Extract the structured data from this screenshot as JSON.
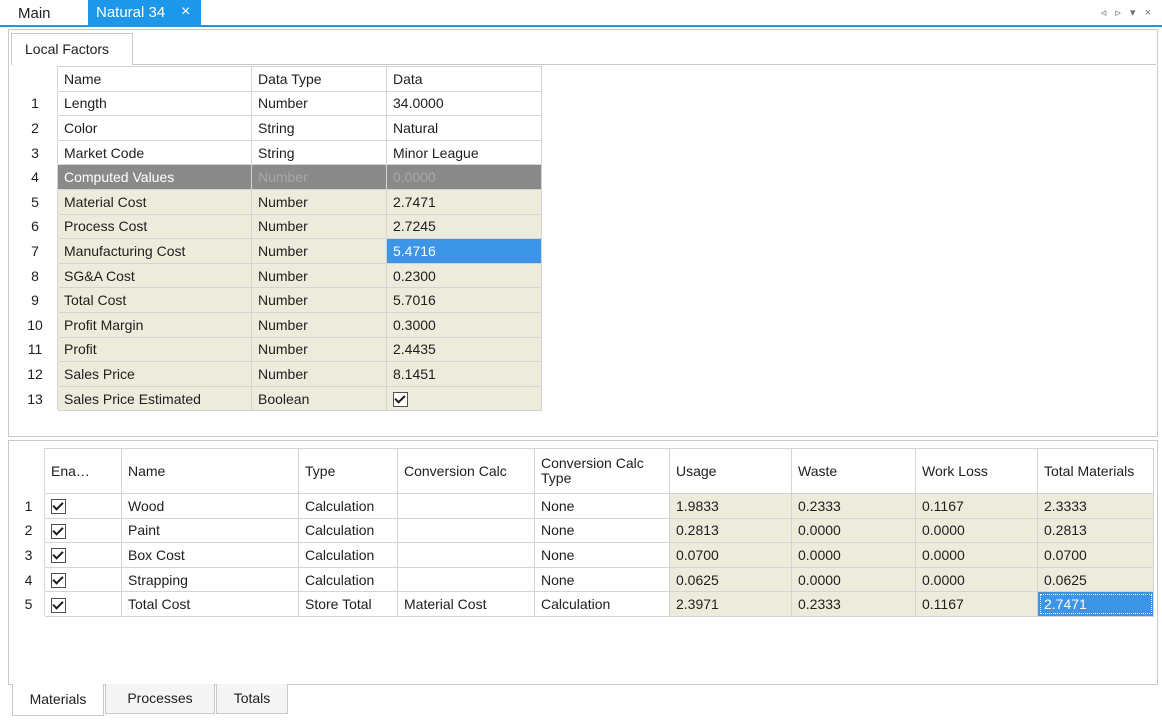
{
  "doc_tabs": {
    "main": "Main",
    "active": "Natural 34",
    "close_glyph": "×"
  },
  "strip_controls": {
    "left": "◃",
    "right": "▹",
    "menu": "▾",
    "close": "×"
  },
  "local_factors": {
    "tab_label": "Local Factors",
    "headers": {
      "name": "Name",
      "data_type": "Data Type",
      "data": "Data"
    },
    "rows": [
      {
        "num": "1",
        "name": "Length",
        "type": "Number",
        "data": "34.0000"
      },
      {
        "num": "2",
        "name": "Color",
        "type": "String",
        "data": "Natural"
      },
      {
        "num": "3",
        "name": "Market Code",
        "type": "String",
        "data": "Minor League"
      },
      {
        "num": "4",
        "name": "Computed Values",
        "type": "Number",
        "data": "0.0000"
      },
      {
        "num": "5",
        "name": "Material Cost",
        "type": "Number",
        "data": "2.7471"
      },
      {
        "num": "6",
        "name": "Process Cost",
        "type": "Number",
        "data": "2.7245"
      },
      {
        "num": "7",
        "name": "Manufacturing Cost",
        "type": "Number",
        "data": "5.4716"
      },
      {
        "num": "8",
        "name": "SG&A Cost",
        "type": "Number",
        "data": "0.2300"
      },
      {
        "num": "9",
        "name": "Total Cost",
        "type": "Number",
        "data": "5.7016"
      },
      {
        "num": "10",
        "name": "Profit Margin",
        "type": "Number",
        "data": "0.3000"
      },
      {
        "num": "11",
        "name": "Profit",
        "type": "Number",
        "data": "2.4435"
      },
      {
        "num": "12",
        "name": "Sales Price",
        "type": "Number",
        "data": "8.1451"
      },
      {
        "num": "13",
        "name": "Sales Price Estimated",
        "type": "Boolean",
        "data": ""
      }
    ]
  },
  "materials": {
    "headers": {
      "enabled": "Ena…",
      "name": "Name",
      "type": "Type",
      "conv_calc": "Conversion Calc",
      "conv_calc_type": "Conversion Calc Type",
      "usage": "Usage",
      "waste": "Waste",
      "work_loss": "Work Loss",
      "total_materials": "Total Materials"
    },
    "rows": [
      {
        "num": "1",
        "name": "Wood",
        "type": "Calculation",
        "conv_calc": "",
        "conv_calc_type": "None",
        "usage": "1.9833",
        "waste": "0.2333",
        "work_loss": "0.1167",
        "total": "2.3333"
      },
      {
        "num": "2",
        "name": "Paint",
        "type": "Calculation",
        "conv_calc": "",
        "conv_calc_type": "None",
        "usage": "0.2813",
        "waste": "0.0000",
        "work_loss": "0.0000",
        "total": "0.2813"
      },
      {
        "num": "3",
        "name": "Box Cost",
        "type": "Calculation",
        "conv_calc": "",
        "conv_calc_type": "None",
        "usage": "0.0700",
        "waste": "0.0000",
        "work_loss": "0.0000",
        "total": "0.0700"
      },
      {
        "num": "4",
        "name": "Strapping",
        "type": "Calculation",
        "conv_calc": "",
        "conv_calc_type": "None",
        "usage": "0.0625",
        "waste": "0.0000",
        "work_loss": "0.0000",
        "total": "0.0625"
      },
      {
        "num": "5",
        "name": "Total Cost",
        "type": "Store Total",
        "conv_calc": "Material Cost",
        "conv_calc_type": "Calculation",
        "usage": "2.3971",
        "waste": "0.2333",
        "work_loss": "0.1167",
        "total": "2.7471"
      }
    ]
  },
  "bottom_tabs": {
    "materials": "Materials",
    "processes": "Processes",
    "totals": "Totals"
  },
  "colors": {
    "accent": "#1c97ea",
    "selection": "#3d95e7",
    "computed_cell": "#ecebdc",
    "group_row": "#8a8a8a"
  }
}
